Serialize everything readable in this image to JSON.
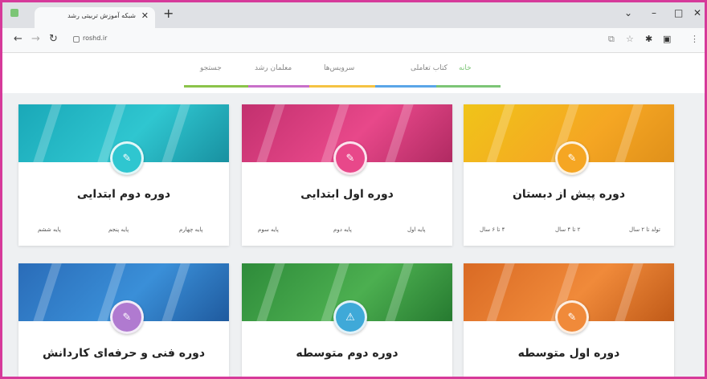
{
  "browser": {
    "tab_title": "شبکه آموزش تربیتی رشد",
    "tab_close": "✕",
    "new_tab": "+",
    "url": "roshd.ir",
    "controls": {
      "minimize": "–",
      "maximize": "□",
      "close": "✕",
      "dropdown": "⌄"
    }
  },
  "sitenav": {
    "items": [
      "خانه",
      "کتاب تعاملی",
      "سرویس‌ها",
      "معلمان رشد",
      "جستجو"
    ],
    "colors": [
      "#8bc34a",
      "#3f8fd8",
      "#f5c242",
      "#e84a8a",
      "#7cc576"
    ]
  },
  "cards": [
    {
      "title": "دوره پیش از دبستان",
      "colors": [
        "#f5a623",
        "#f0c419"
      ],
      "grades": [
        "تولد تا ۲ سال",
        "۲ تا ۴ سال",
        "۴ تا ۶ سال"
      ]
    },
    {
      "title": "دوره اول ابتدایی",
      "colors": [
        "#e8488a",
        "#c2306e"
      ],
      "grades": [
        "پایه اول",
        "پایه دوم",
        "پایه سوم"
      ]
    },
    {
      "title": "دوره دوم ابتدایی",
      "colors": [
        "#2fc6d0",
        "#1aa8b8"
      ],
      "grades": [
        "پایه چهارم",
        "پایه پنجم",
        "پایه ششم"
      ]
    },
    {
      "title": "دوره اول متوسطه",
      "colors": [
        "#f08a3a",
        "#d96a24"
      ],
      "grades": []
    },
    {
      "title": "دوره دوم متوسطه",
      "colors": [
        "#4caf50",
        "#2e8b3a"
      ],
      "grades": []
    },
    {
      "title": "دوره فنی و حرفه‌ای کاردانش",
      "colors": [
        "#3a8fd8",
        "#2a6cb8"
      ],
      "grades": []
    }
  ]
}
